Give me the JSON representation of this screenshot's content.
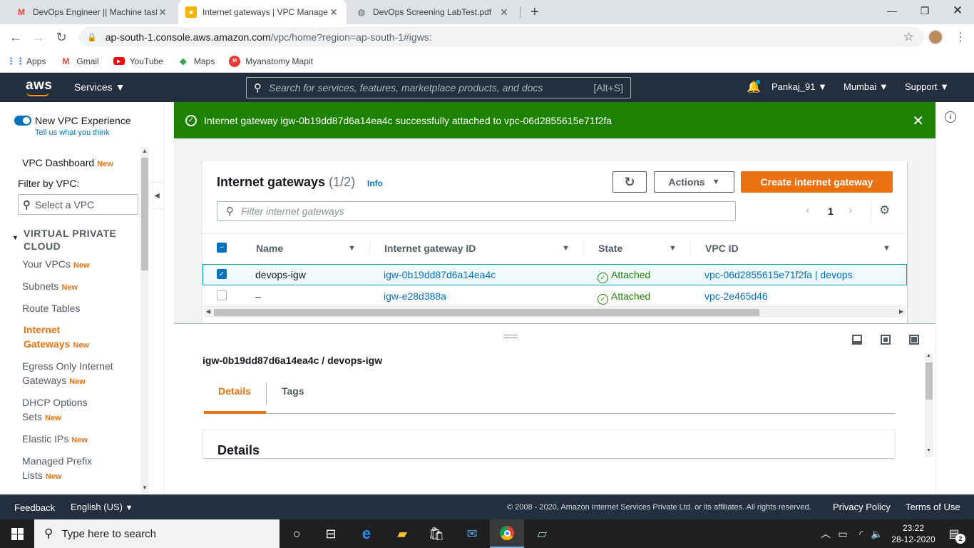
{
  "browser": {
    "tabs": [
      {
        "title": "DevOps Engineer || Machine task",
        "icon": "gmail-icon",
        "active": false
      },
      {
        "title": "Internet gateways | VPC Manager",
        "icon": "aws-icon",
        "active": true
      },
      {
        "title": "DevOps Screening LabTest.pdf",
        "icon": "globe-icon",
        "active": false
      }
    ],
    "url_host": "ap-south-1.console.aws.amazon.com",
    "url_path": "/vpc/home?region=ap-south-1#igws:",
    "bookmarks": [
      {
        "label": "Apps",
        "icon": "apps-grid-icon",
        "color": "#ea4335"
      },
      {
        "label": "Gmail",
        "icon": "gmail-icon",
        "color": "#ea4335"
      },
      {
        "label": "YouTube",
        "icon": "youtube-icon",
        "color": "#ff0000"
      },
      {
        "label": "Maps",
        "icon": "maps-icon",
        "color": "#34a853"
      },
      {
        "label": "Myanatomy Mapit",
        "icon": "myanatomy-icon",
        "color": "#e53935"
      }
    ]
  },
  "aws_header": {
    "logo": "aws",
    "services": "Services",
    "search_placeholder": "Search for services, features, marketplace products, and docs",
    "search_shortcut": "[Alt+S]",
    "user": "Pankaj_91",
    "region": "Mumbai",
    "support": "Support"
  },
  "sidebar": {
    "toggle_label": "New VPC Experience",
    "feedback_link": "Tell us what you think",
    "dashboard": "VPC Dashboard",
    "new_badge": "New",
    "filter_label": "Filter by VPC:",
    "filter_placeholder": "Select a VPC",
    "section_title_1": "VIRTUAL PRIVATE",
    "section_title_2": "CLOUD",
    "items": [
      {
        "label": "Your VPCs",
        "new": true
      },
      {
        "label": "Subnets",
        "new": true
      },
      {
        "label": "Route Tables",
        "new": false
      },
      {
        "label": "Internet",
        "label2": "Gateways",
        "new": true,
        "active": true
      },
      {
        "label": "Egress Only Internet",
        "label2": "Gateways",
        "new": true
      },
      {
        "label": "DHCP Options",
        "label2": "Sets",
        "new": true
      },
      {
        "label": "Elastic IPs",
        "new": true
      },
      {
        "label": "Managed Prefix",
        "label2": "Lists",
        "new": true
      }
    ]
  },
  "flash": {
    "message": "Internet gateway igw-0b19dd87d6a14ea4c successfully attached to vpc-06d2855615e71f2fa",
    "color": "#1d8102"
  },
  "table": {
    "title": "Internet gateways",
    "count": "(1/2)",
    "info": "Info",
    "actions": "Actions",
    "create": "Create internet gateway",
    "filter_placeholder": "Filter internet gateways",
    "page": "1",
    "columns": [
      "Name",
      "Internet gateway ID",
      "State",
      "VPC ID"
    ],
    "rows": [
      {
        "name": "devops-igw",
        "id": "igw-0b19dd87d6a14ea4c",
        "state": "Attached",
        "vpc": "vpc-06d2855615e71f2fa | devops",
        "selected": true
      },
      {
        "name": "–",
        "id": "igw-e28d388a",
        "state": "Attached",
        "vpc": "vpc-2e465d46",
        "selected": false
      }
    ]
  },
  "split_panel": {
    "title": "igw-0b19dd87d6a14ea4c / devops-igw",
    "tabs": [
      "Details",
      "Tags"
    ],
    "section": "Details"
  },
  "footer": {
    "feedback": "Feedback",
    "language": "English (US)",
    "copyright": "© 2008 - 2020, Amazon Internet Services Private Ltd. or its affiliates. All rights reserved.",
    "privacy": "Privacy Policy",
    "terms": "Terms of Use"
  },
  "taskbar": {
    "search_placeholder": "Type here to search",
    "time": "23:22",
    "date": "28-12-2020",
    "notifications": "2"
  },
  "colors": {
    "aws_dark": "#232f3e",
    "aws_orange": "#ec7211",
    "link_blue": "#0073bb",
    "success_green": "#1d8102"
  }
}
